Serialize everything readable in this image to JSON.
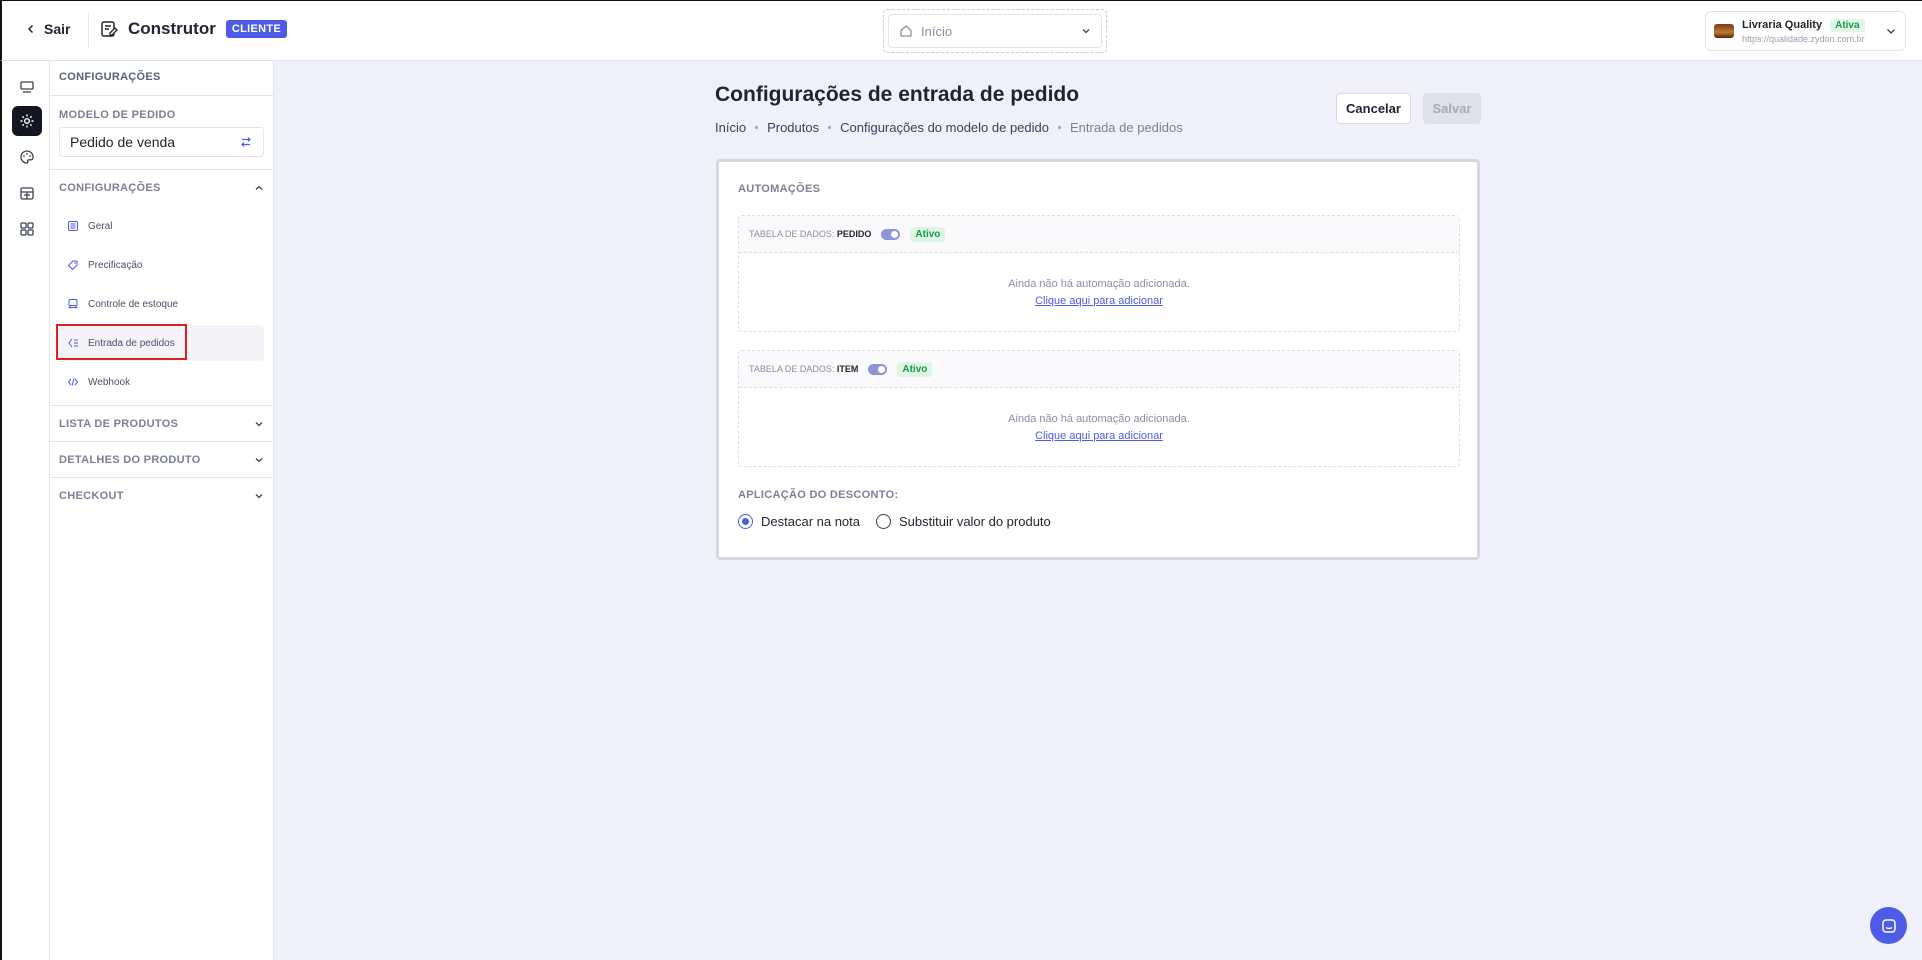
{
  "header": {
    "back_label": "Sair",
    "app_title": "Construtor",
    "badge": "CLIENTE",
    "nav_select_value": "Início",
    "store": {
      "name": "Livraria Quality",
      "status": "Ativa",
      "url": "https://qualidade.zydon.com.br"
    }
  },
  "sidebar": {
    "title": "CONFIGURAÇÕES",
    "model_label": "MODELO DE PEDIDO",
    "model_value": "Pedido de venda",
    "section_config": "CONFIGURAÇÕES",
    "items": [
      {
        "label": "Geral",
        "icon": "list-icon"
      },
      {
        "label": "Precificação",
        "icon": "tag-icon"
      },
      {
        "label": "Controle de estoque",
        "icon": "box-icon"
      },
      {
        "label": "Entrada de pedidos",
        "icon": "order-entry-icon"
      },
      {
        "label": "Webhook",
        "icon": "code-icon"
      }
    ],
    "active_item": "Entrada de pedidos",
    "sections": [
      "LISTA DE PRODUTOS",
      "DETALHES DO PRODUTO",
      "CHECKOUT"
    ]
  },
  "main": {
    "title": "Configurações de entrada de pedido",
    "breadcrumb": [
      "Início",
      "Produtos",
      "Configurações do modelo de pedido",
      "Entrada de pedidos"
    ],
    "cancel_label": "Cancelar",
    "save_label": "Salvar",
    "automations_title": "AUTOMAÇÕES",
    "tables": [
      {
        "prefix": "TABELA DE DADOS:",
        "name": "PEDIDO",
        "status": "Ativo",
        "empty_text": "Ainda não há automação adicionada.",
        "add_link": "Clique aqui para adicionar"
      },
      {
        "prefix": "TABELA DE DADOS:",
        "name": "ITEM",
        "status": "Ativo",
        "empty_text": "Ainda não há automação adicionada.",
        "add_link": "Clique aqui para adicionar"
      }
    ],
    "discount_label": "APLICAÇÃO DO DESCONTO:",
    "discount_options": [
      "Destacar na nota",
      "Substituir valor do produto"
    ],
    "discount_selected": "Destacar na nota"
  },
  "colors": {
    "accent": "#4d5be6",
    "success": "#1a9a4c",
    "background": "#f0f0fa",
    "highlight": "#e02020"
  }
}
